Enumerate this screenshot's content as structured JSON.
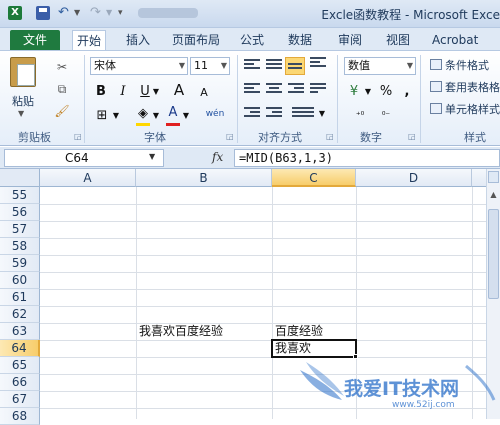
{
  "window": {
    "title": "Excle函数教程 - Microsoft Exce",
    "app_badge": "X"
  },
  "ribbon_tabs": [
    "文件",
    "开始",
    "插入",
    "页面布局",
    "公式",
    "数据",
    "审阅",
    "视图",
    "Acrobat"
  ],
  "active_tab": "开始",
  "clipboard": {
    "paste_label": "粘贴",
    "group_label": "剪贴板"
  },
  "font": {
    "name": "宋体",
    "size": "11",
    "group_label": "字体",
    "bold": "B",
    "italic": "I",
    "underline": "U",
    "grow": "A",
    "shrink": "A",
    "font_color": "A",
    "phonetic": "wén"
  },
  "alignment": {
    "group_label": "对齐方式"
  },
  "number": {
    "format": "数值",
    "group_label": "数字",
    "percent": "%",
    "comma": ",",
    "currency": "¥"
  },
  "styles": {
    "items": [
      "条件格式",
      "套用表格格",
      "单元格样式"
    ],
    "group_label": "样式"
  },
  "formula_bar": {
    "name_box": "C64",
    "fx": "fx",
    "formula": "=MID(B63,1,3)"
  },
  "grid": {
    "columns": [
      "A",
      "B",
      "C",
      "D"
    ],
    "selected_column": "C",
    "rows": [
      "55",
      "56",
      "57",
      "58",
      "59",
      "60",
      "61",
      "62",
      "63",
      "64",
      "65",
      "66",
      "67",
      "68"
    ],
    "selected_row": "64",
    "cells": {
      "B63": "我喜欢百度经验",
      "C63": "百度经验",
      "C64": "我喜欢"
    }
  },
  "watermark": {
    "text": "我爱IT技术网",
    "url": "www.52ij.com"
  },
  "colors": {
    "file_tab": "#1f7a3f",
    "selection": "#f7cd6b",
    "ribbon_bg": "#dfe9f5"
  }
}
